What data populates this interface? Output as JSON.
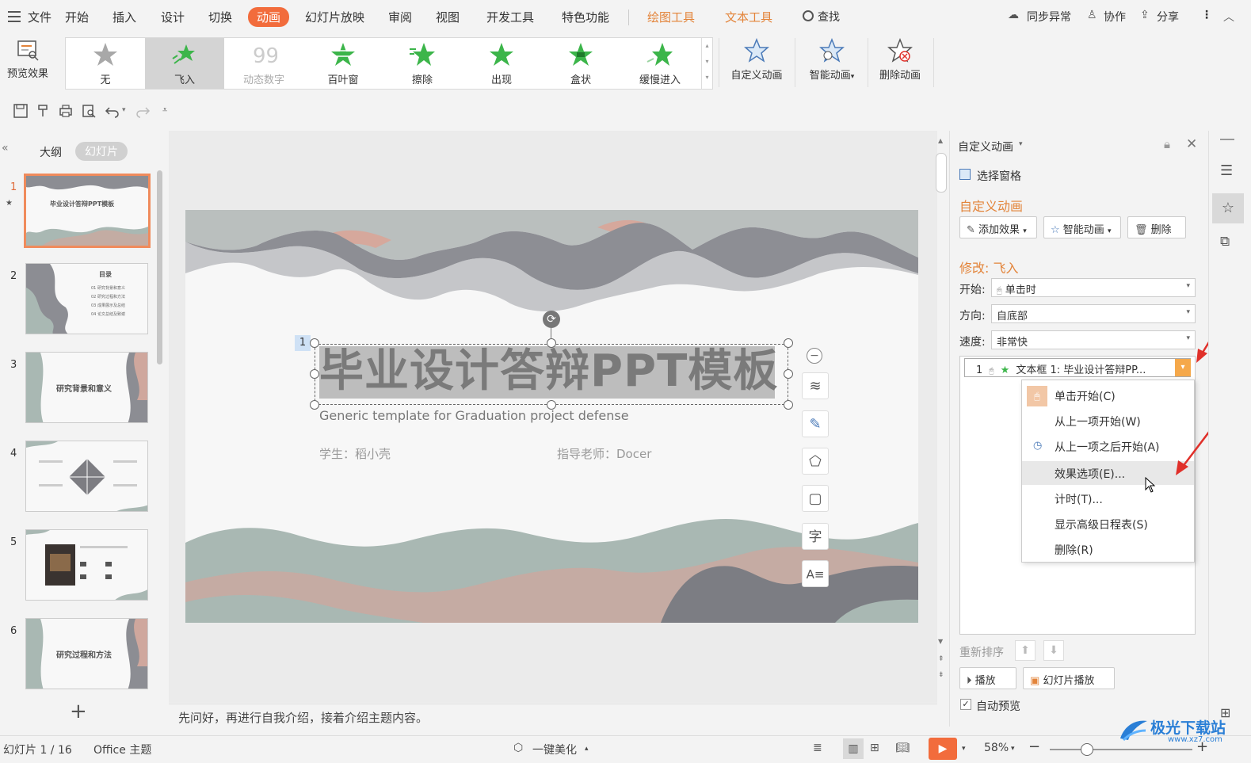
{
  "menu": {
    "items": [
      "文件",
      "开始",
      "插入",
      "设计",
      "切换",
      "动画",
      "幻灯片放映",
      "审阅",
      "视图",
      "开发工具",
      "特色功能",
      "绘图工具",
      "文本工具"
    ],
    "search": "查找",
    "sync": "同步异常",
    "collab": "协作",
    "share": "分享"
  },
  "ribbon": {
    "preview": "预览效果",
    "gallery": [
      "无",
      "飞入",
      "动态数字",
      "百叶窗",
      "擦除",
      "出现",
      "盒状",
      "缓慢进入"
    ],
    "custom_anim": "自定义动画",
    "smart_anim": "智能动画",
    "delete_anim": "删除动画"
  },
  "left": {
    "tab_outline": "大纲",
    "tab_slides": "幻灯片",
    "slide_numbers": [
      "1",
      "2",
      "3",
      "4",
      "5",
      "6"
    ],
    "thumb_titles": [
      "毕业设计答辩PPT模板",
      "目录",
      "研究背景和意义",
      "",
      "",
      "研究过程和方法"
    ],
    "toc_items": [
      "01  研究背景和意义",
      "02  研究过程和方法",
      "03  成果展示及总结",
      "04  论文总结及致谢"
    ],
    "add_slide": "+"
  },
  "slide": {
    "anim_tag": "1",
    "title": "毕业设计答辩PPT模板",
    "subtitle": "Generic template for Graduation project defense",
    "student": "学生：稻小壳",
    "teacher": "指导老师：Docer"
  },
  "notes": "先问好，再进行自我介绍，接着介绍主题内容。",
  "panel": {
    "header": "自定义动画",
    "selection_pane": "选择窗格",
    "section_title": "自定义动画",
    "add_effect": "添加效果",
    "smart_anim": "智能动画",
    "delete": "删除",
    "modify_title": "修改: 飞入",
    "start_label": "开始:",
    "start_value": "单击时",
    "direction_label": "方向:",
    "direction_value": "自底部",
    "speed_label": "速度:",
    "speed_value": "非常快",
    "list_item_num": "1",
    "list_item_text": "文本框 1: 毕业设计答辩PP...",
    "reorder": "重新排序",
    "play": "播放",
    "slideshow": "幻灯片播放",
    "auto_preview": "自动预览"
  },
  "context_menu": [
    "单击开始(C)",
    "从上一项开始(W)",
    "从上一项之后开始(A)",
    "效果选项(E)...",
    "计时(T)...",
    "显示高级日程表(S)",
    "删除(R)"
  ],
  "status": {
    "slide_info": "幻灯片 1 / 16",
    "theme": "Office 主题",
    "beautify": "一键美化",
    "zoom": "58%"
  },
  "watermark": {
    "text": "极光下载站",
    "url": "www.xz7.com"
  },
  "colors": {
    "accent": "#f26c3c",
    "tool_orange": "#e3843a",
    "star_green": "#3cb54a",
    "arrow_red": "#e0302a"
  }
}
